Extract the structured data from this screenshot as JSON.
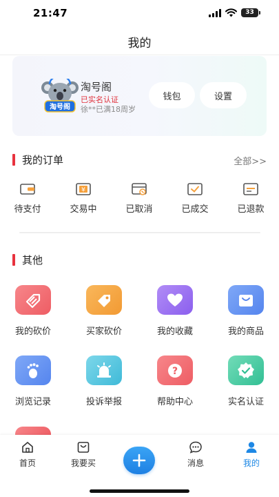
{
  "status_bar": {
    "time": "21:47",
    "battery": "33"
  },
  "nav": {
    "title": "我的"
  },
  "profile": {
    "name": "淘号阁",
    "verified": "已实名认证",
    "age_note": "徐**已满18周岁",
    "logo_text": "淘号阁",
    "wallet_label": "钱包",
    "settings_label": "设置"
  },
  "orders": {
    "title": "我的订单",
    "all_link": "全部>>",
    "items": [
      {
        "label": "待支付",
        "icon": "wallet-icon"
      },
      {
        "label": "交易中",
        "icon": "yen-icon"
      },
      {
        "label": "已取消",
        "icon": "cancel-box-icon"
      },
      {
        "label": "已成交",
        "icon": "check-box-icon"
      },
      {
        "label": "已退款",
        "icon": "refund-icon"
      }
    ]
  },
  "other": {
    "title": "其他",
    "items": [
      {
        "label": "我的砍价",
        "icon": "price-tag-icon",
        "color": "#f2636b"
      },
      {
        "label": "买家砍价",
        "icon": "tag-icon",
        "color": "#f5a03c"
      },
      {
        "label": "我的收藏",
        "icon": "heart-icon",
        "color": "#9a6ff0"
      },
      {
        "label": "我的商品",
        "icon": "shopping-box-icon",
        "color": "#5d8ef2"
      },
      {
        "label": "浏览记录",
        "icon": "footprint-icon",
        "color": "#5d8ef2"
      },
      {
        "label": "投诉举报",
        "icon": "alarm-icon",
        "color": "#4fc3dd"
      },
      {
        "label": "帮助中心",
        "icon": "help-icon",
        "color": "#f2636b"
      },
      {
        "label": "实名认证",
        "icon": "verified-badge-icon",
        "color": "#37c39a"
      }
    ]
  },
  "tabs": [
    {
      "label": "首页",
      "icon": "home-icon"
    },
    {
      "label": "我要买",
      "icon": "shopping-bag-icon"
    },
    {
      "label": "",
      "icon": "plus-icon"
    },
    {
      "label": "消息",
      "icon": "chat-icon"
    },
    {
      "label": "我的",
      "icon": "user-icon",
      "active": true
    }
  ],
  "colors": {
    "accent": "#1e88e5",
    "section_bar": "#e8323e",
    "verified": "#e0313b"
  }
}
